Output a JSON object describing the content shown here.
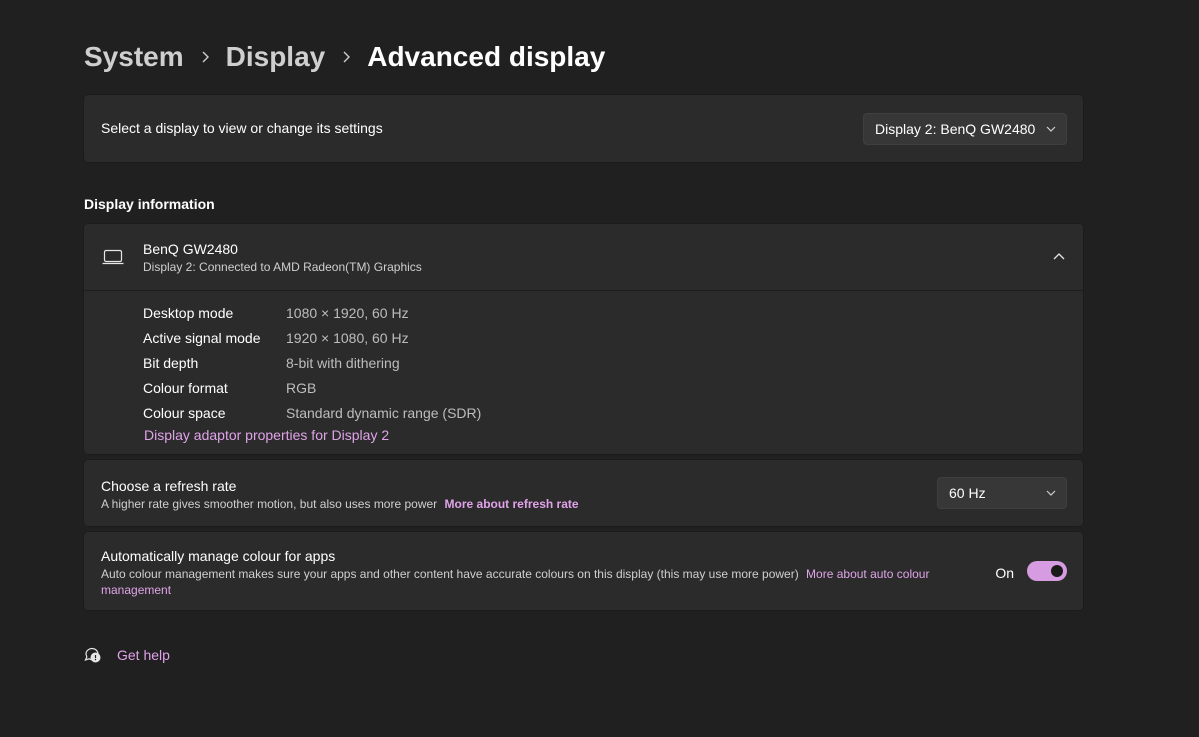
{
  "breadcrumb": {
    "items": [
      "System",
      "Display"
    ],
    "current": "Advanced display"
  },
  "display_select": {
    "label": "Select a display to view or change its settings",
    "selected": "Display 2: BenQ GW2480"
  },
  "display_info": {
    "section_title": "Display information",
    "name": "BenQ GW2480",
    "subtitle": "Display 2: Connected to AMD Radeon(TM) Graphics",
    "expanded": true,
    "rows": [
      {
        "key": "Desktop mode",
        "value": "1080 × 1920, 60 Hz"
      },
      {
        "key": "Active signal mode",
        "value": "1920 × 1080, 60 Hz"
      },
      {
        "key": "Bit depth",
        "value": "8-bit with dithering"
      },
      {
        "key": "Colour format",
        "value": "RGB"
      },
      {
        "key": "Colour space",
        "value": "Standard dynamic range (SDR)"
      }
    ],
    "adaptor_link": "Display adaptor properties for Display 2"
  },
  "refresh_rate": {
    "title": "Choose a refresh rate",
    "description": "A higher rate gives smoother motion, but also uses more power",
    "link": "More about refresh rate",
    "selected": "60 Hz"
  },
  "auto_colour": {
    "title": "Automatically manage colour for apps",
    "description": "Auto colour management makes sure your apps and other content have accurate colours on this display (this may use more power)",
    "link": "More about auto colour management",
    "toggle_label": "On",
    "toggle_state": true
  },
  "help": {
    "label": "Get help"
  },
  "colors": {
    "background": "#202020",
    "card": "#2b2b2b",
    "accent": "#d69be0",
    "link": "#e0a3e9"
  }
}
